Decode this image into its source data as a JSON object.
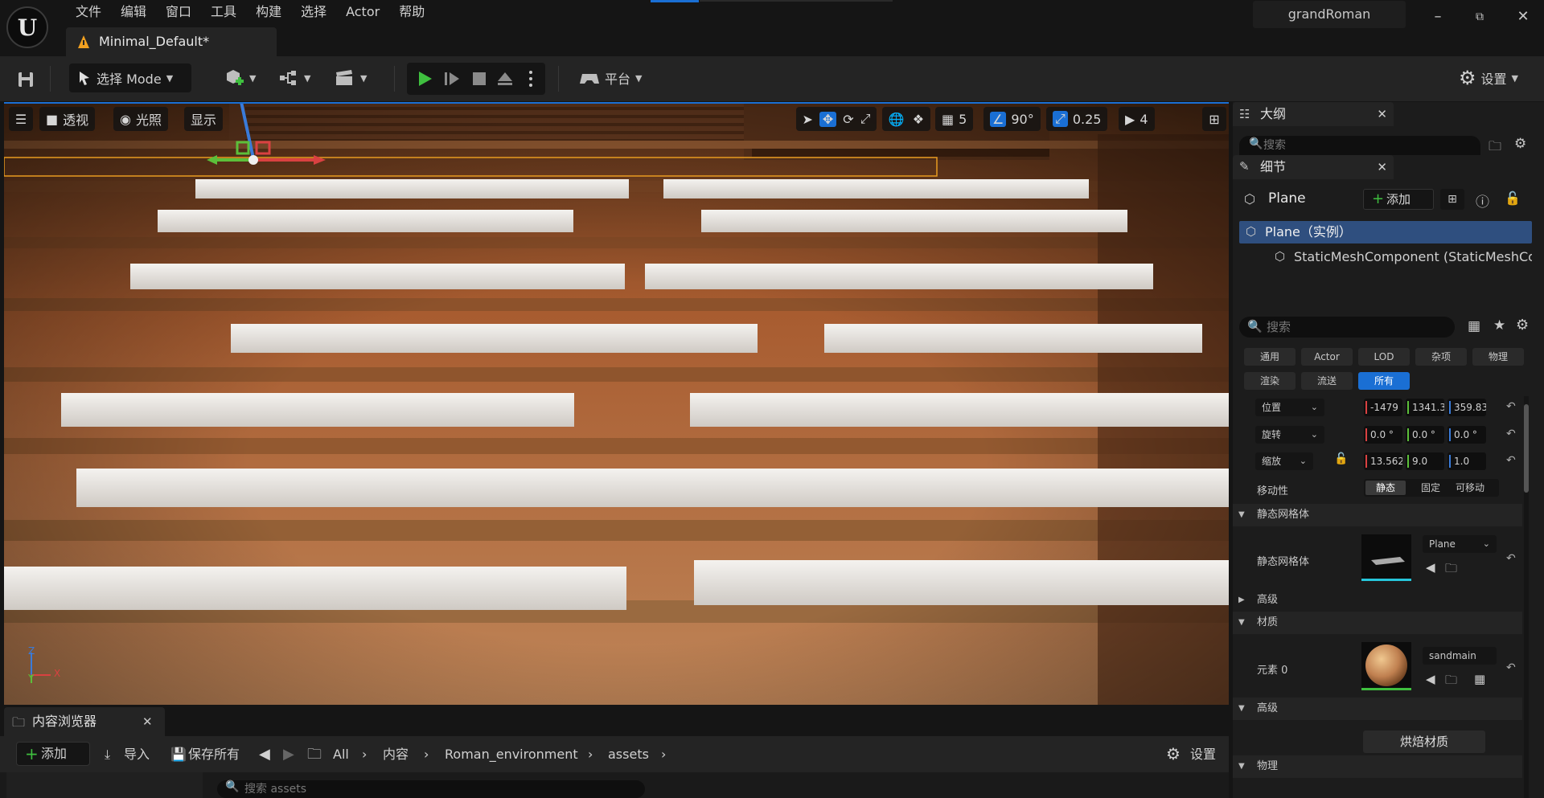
{
  "app": {
    "menu": [
      "文件",
      "编辑",
      "窗口",
      "工具",
      "构建",
      "选择",
      "Actor",
      "帮助"
    ],
    "user": "grandRoman",
    "doc_tab": "Minimal_Default*"
  },
  "toolbar": {
    "mode_label": "选择 Mode",
    "platform_label": "平台",
    "settings_label": "设置"
  },
  "viewport": {
    "view_mode": "透视",
    "lighting": "光照",
    "show": "显示",
    "grid_snap": "5",
    "rotation_snap": "90°",
    "scale_snap": "0.25",
    "camera_speed": "4",
    "axis_z": "Z",
    "axis_y": "Y",
    "axis_x": "X"
  },
  "content_browser": {
    "tab_label": "内容浏览器",
    "add_label": "添加",
    "import_label": "导入",
    "save_all_label": "保存所有",
    "breadcrumb": [
      "All",
      "内容",
      "Roman_environment",
      "assets"
    ],
    "settings_label": "设置",
    "search_placeholder": "搜索 assets"
  },
  "outline": {
    "tab_label": "大纲",
    "search_placeholder": "搜索"
  },
  "details": {
    "tab_label": "细节",
    "actor_name": "Plane",
    "add_label": "添加",
    "tree": [
      "Plane（实例）",
      "StaticMeshComponent (StaticMeshCo"
    ],
    "search_placeholder": "搜索",
    "filters_row1": [
      "通用",
      "Actor",
      "LOD",
      "杂项",
      "物理"
    ],
    "filters_row2": [
      "渲染",
      "流送",
      "所有"
    ],
    "location_label": "位置",
    "location": [
      "-1479",
      "1341.3",
      "359.83"
    ],
    "rotation_label": "旋转",
    "rotation": [
      "0.0 °",
      "0.0 °",
      "0.0 °"
    ],
    "scale_label": "缩放",
    "scale": [
      "13.562",
      "9.0",
      "1.0"
    ],
    "mobility_label": "移动性",
    "mobility_options": [
      "静态",
      "固定",
      "可移动"
    ],
    "section_static_mesh": "静态网格体",
    "static_mesh_label": "静态网格体",
    "static_mesh_value": "Plane",
    "advanced_label": "高级",
    "section_materials": "材质",
    "element0_label": "元素 0",
    "material_value": "sandmain",
    "advanced_label2": "高级",
    "bake_button": "烘焙材质",
    "section_physics": "物理"
  },
  "colors": {
    "accent_blue": "#1a6fd4",
    "play_green": "#3fbf3f",
    "axis_red": "#d94141",
    "axis_green": "#5cbf3a",
    "axis_blue": "#3a7bd9",
    "warning_orange": "#f0a020"
  }
}
